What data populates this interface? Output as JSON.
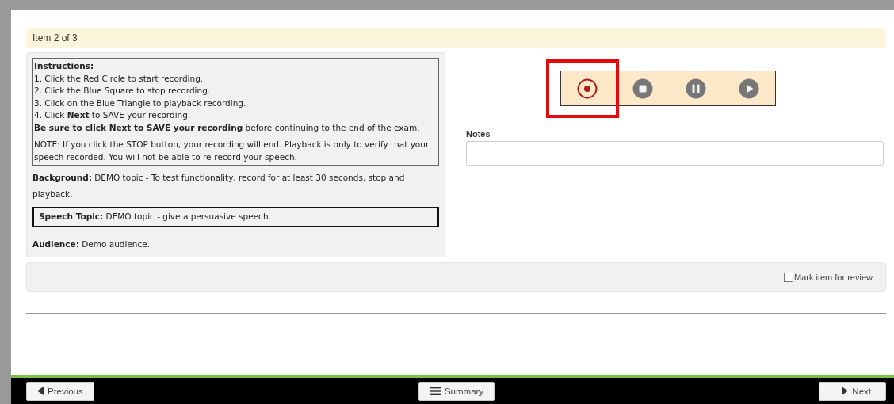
{
  "item_header": "Item 2 of 3",
  "instructions": {
    "title": "Instructions:",
    "lines": [
      "1. Click the Red Circle to start recording.",
      "2. Click the Blue Square to stop recording.",
      "3. Click on the Blue Triangle to playback recording.",
      "4. Click **Next** to SAVE your recording.",
      "**Be sure to click Next to SAVE your recording** before continuing to the end of the exam."
    ],
    "note": "NOTE: If you click the STOP button, your recording will end. Playback is only to verify that your speech recorded. You will not be able to re-record your speech."
  },
  "background": "**Background:** DEMO topic - To test functionality, record for at least 30 seconds, stop and playback.",
  "speech_topic": "**Speech Topic:** DEMO topic - give a persuasive speech.",
  "audience": "**Audience:** Demo audience.",
  "player_controls": [
    {
      "kind": "record",
      "highlighted": true
    },
    {
      "kind": "stop",
      "highlighted": false
    },
    {
      "kind": "pause",
      "highlighted": false
    },
    {
      "kind": "play",
      "highlighted": false
    }
  ],
  "notes": {
    "label": "Notes"
  },
  "review": {
    "label": "Mark item for review",
    "checked": false
  },
  "footer": {
    "previous": "Previous",
    "summary": "Summary",
    "next": "Next"
  }
}
